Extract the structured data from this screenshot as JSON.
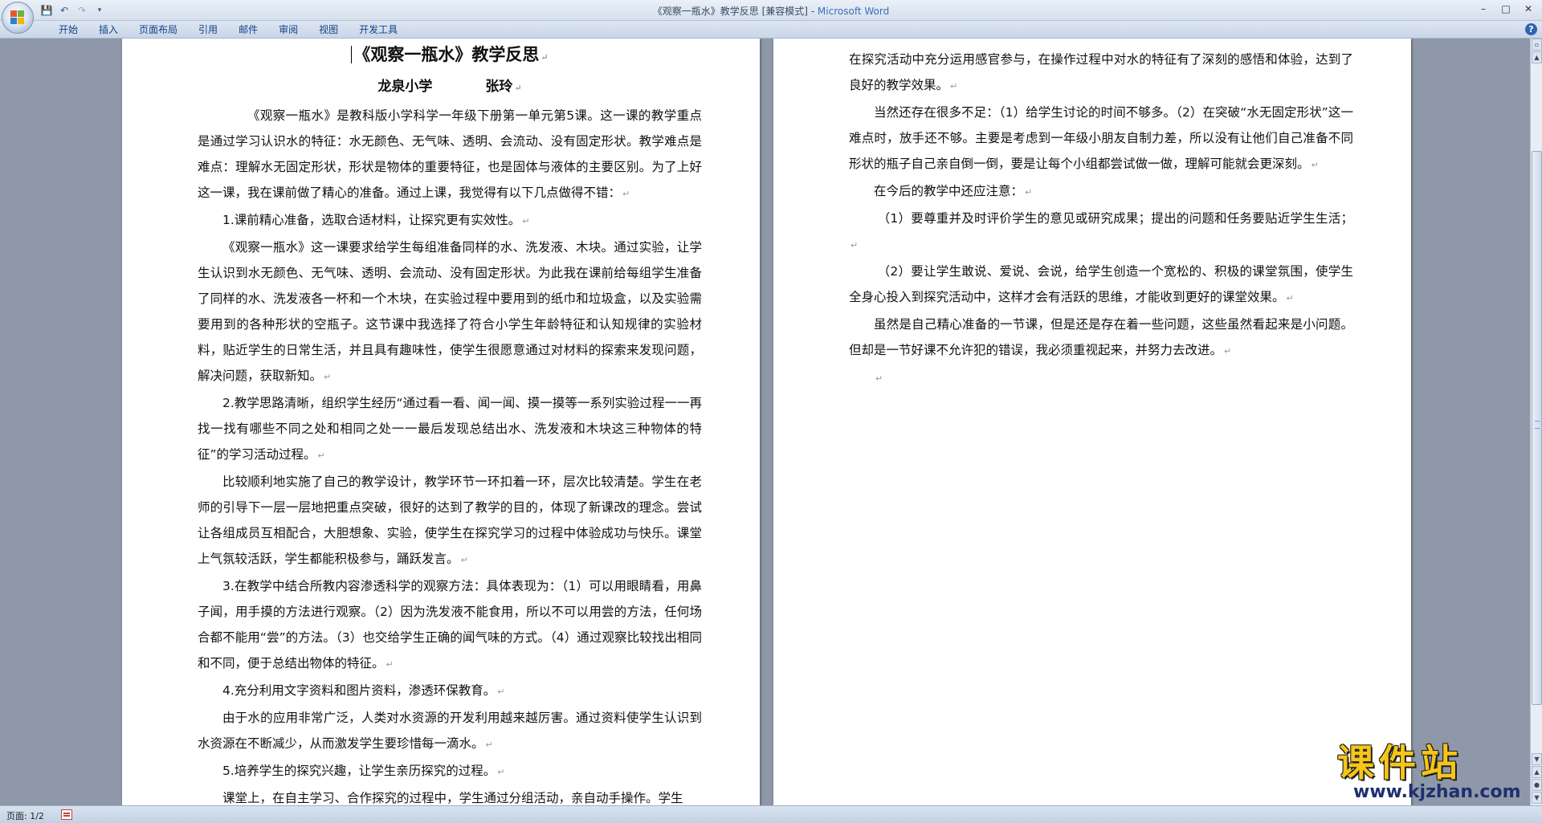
{
  "window": {
    "title_doc": "《观察一瓶水》教学反思 [兼容模式] - ",
    "title_app": "Microsoft Word",
    "minimize": "–",
    "maximize": "□",
    "close": "✕"
  },
  "qat": {
    "save_icon": "save-icon",
    "undo_icon": "undo-icon",
    "redo_icon": "redo-icon",
    "customize_icon": "dropdown-icon"
  },
  "ribbon": {
    "tabs": [
      "开始",
      "插入",
      "页面布局",
      "引用",
      "邮件",
      "审阅",
      "视图",
      "开发工具"
    ],
    "help": "?"
  },
  "document": {
    "title": "《观察一瓶水》教学反思",
    "author": "龙泉小学 张玲",
    "page1_paragraphs": [
      "《观察一瓶水》是教科版小学科学一年级下册第一单元第5课。这一课的教学重点是通过学习认识水的特征：水无颜色、无气味、透明、会流动、没有固定形状。教学难点是难点：理解水无固定形状，形状是物体的重要特征，也是固体与液体的主要区别。为了上好这一课，我在课前做了精心的准备。通过上课，我觉得有以下几点做得不错：",
      "1.课前精心准备，选取合适材料，让探究更有实效性。",
      "《观察一瓶水》这一课要求给学生每组准备同样的水、洗发液、木块。通过实验，让学生认识到水无颜色、无气味、透明、会流动、没有固定形状。为此我在课前给每组学生准备了同样的水、洗发液各一杯和一个木块，在实验过程中要用到的纸巾和垃圾盒，以及实验需要用到的各种形状的空瓶子。这节课中我选择了符合小学生年龄特征和认知规律的实验材料，贴近学生的日常生活，并且具有趣味性，使学生很愿意通过对材料的探索来发现问题，解决问题，获取新知。",
      "2.教学思路清晰，组织学生经历“通过看一看、闻一闻、摸一摸等一系列实验过程一一再找一找有哪些不同之处和相同之处一一最后发现总结出水、洗发液和木块这三种物体的特征”的学习活动过程。",
      "比较顺利地实施了自己的教学设计，教学环节一环扣着一环，层次比较清楚。学生在老师的引导下一层一层地把重点突破，很好的达到了教学的目的，体现了新课改的理念。尝试让各组成员互相配合，大胆想象、实验，使学生在探究学习的过程中体验成功与快乐。课堂上气氛较活跃，学生都能积极参与，踊跃发言。",
      "3.在教学中结合所教内容渗透科学的观察方法：具体表现为：（1）可以用眼睛看，用鼻子闻，用手摸的方法进行观察。（2）因为洗发液不能食用，所以不可以用尝的方法，任何场合都不能用“尝”的方法。（3）也交给学生正确的闻气味的方式。（4）通过观察比较找出相同和不同，便于总结出物体的特征。",
      "4.充分利用文字资料和图片资料，渗透环保教育。",
      "由于水的应用非常广泛，人类对水资源的开发利用越来越厉害。通过资料使学生认识到水资源在不断减少，从而激发学生要珍惜每一滴水。",
      "5.培养学生的探究兴趣，让学生亲历探究的过程。",
      "课堂上，在自主学习、合作探究的过程中，学生通过分组活动，亲自动手操作。学生"
    ],
    "page2_paragraphs": [
      "在探究活动中充分运用感官参与，在操作过程中对水的特征有了深刻的感悟和体验，达到了良好的教学效果。",
      "当然还存在很多不足：（1）给学生讨论的时间不够多。（2）在突破“水无固定形状”这一难点时，放手还不够。主要是考虑到一年级小朋友自制力差，所以没有让他们自己准备不同形状的瓶子自己亲自倒一倒，要是让每个小组都尝试做一做，理解可能就会更深刻。",
      "在今后的教学中还应注意：",
      "（1）要尊重并及时评价学生的意见或研究成果；提出的问题和任务要贴近学生生活；",
      "（2）要让学生敢说、爱说、会说，给学生创造一个宽松的、积极的课堂氛围，使学生全身心投入到探究活动中，这样才会有活跃的思维，才能收到更好的课堂效果。",
      "虽然是自己精心准备的一节课，但是还是存在着一些问题，这些虽然看起来是小问题。但却是一节好课不允许犯的错误，我必须重视起来，并努力去改进。"
    ],
    "paragraph_mark": "↵"
  },
  "status": {
    "page": "页面: 1/2"
  },
  "watermark": {
    "main": "课件站",
    "url": "www.kjzhan.com"
  },
  "colors": {
    "title_app": "#3e6fb6",
    "tab_text": "#15428b",
    "watermark_main": "#f5c518",
    "watermark_url": "#1f2f6e"
  }
}
